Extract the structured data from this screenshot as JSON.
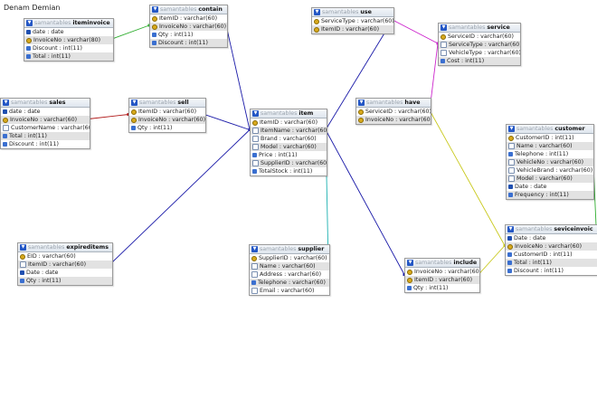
{
  "title": "Denam Demian",
  "tables": [
    {
      "id": "iteminvoice",
      "db": "samantables",
      "name": "iteminvoice",
      "columns": [
        {
          "text": "date : date",
          "icon": "date"
        },
        {
          "text": "InvoiceNo : varchar(80)",
          "icon": "key"
        },
        {
          "text": "Discount : int(11)",
          "icon": "num"
        },
        {
          "text": "Total : int(11)",
          "icon": "num"
        }
      ]
    },
    {
      "id": "contain",
      "db": "samantables",
      "name": "contain",
      "columns": [
        {
          "text": "ItemID : varchar(60)",
          "icon": "key"
        },
        {
          "text": "InvoiceNo : varchar(60)",
          "icon": "key"
        },
        {
          "text": "Qty : int(11)",
          "icon": "num"
        },
        {
          "text": "Discount : int(11)",
          "icon": "num"
        }
      ]
    },
    {
      "id": "use",
      "db": "samantables",
      "name": "use",
      "columns": [
        {
          "text": "ServiceType : varchar(60)",
          "icon": "key"
        },
        {
          "text": "ItemID : varchar(60)",
          "icon": "key"
        }
      ]
    },
    {
      "id": "service",
      "db": "samantables",
      "name": "service",
      "columns": [
        {
          "text": "ServiceID : varchar(60)",
          "icon": "key"
        },
        {
          "text": "ServiceType : varchar(60)",
          "icon": "field"
        },
        {
          "text": "VehicleType : varchar(60)",
          "icon": "field"
        },
        {
          "text": "Cost : int(11)",
          "icon": "num"
        }
      ]
    },
    {
      "id": "sales",
      "db": "samantables",
      "name": "sales",
      "columns": [
        {
          "text": "date : date",
          "icon": "date"
        },
        {
          "text": "InvoiceNo : varchar(60)",
          "icon": "key"
        },
        {
          "text": "CustomerName : varchar(60)",
          "icon": "field"
        },
        {
          "text": "Total : int(11)",
          "icon": "num"
        },
        {
          "text": "Discount : int(11)",
          "icon": "num"
        }
      ]
    },
    {
      "id": "sell",
      "db": "samantables",
      "name": "sell",
      "columns": [
        {
          "text": "ItemID : varchar(60)",
          "icon": "key"
        },
        {
          "text": "InvoiceNo : varchar(60)",
          "icon": "key"
        },
        {
          "text": "Qty : int(11)",
          "icon": "num"
        }
      ]
    },
    {
      "id": "item",
      "db": "samantables",
      "name": "item",
      "columns": [
        {
          "text": "ItemID : varchar(60)",
          "icon": "key"
        },
        {
          "text": "ItemName : varchar(60)",
          "icon": "field"
        },
        {
          "text": "Brand : varchar(60)",
          "icon": "field"
        },
        {
          "text": "Model : varchar(60)",
          "icon": "field"
        },
        {
          "text": "Price : int(11)",
          "icon": "num"
        },
        {
          "text": "SupplierID : varchar(60)",
          "icon": "field"
        },
        {
          "text": "TotalStock : int(11)",
          "icon": "num"
        }
      ]
    },
    {
      "id": "have",
      "db": "samantables",
      "name": "have",
      "columns": [
        {
          "text": "ServiceID : varchar(60)",
          "icon": "key"
        },
        {
          "text": "InvoiceNo : varchar(60)",
          "icon": "key"
        }
      ]
    },
    {
      "id": "customer",
      "db": "samantables",
      "name": "customer",
      "columns": [
        {
          "text": "CustomerID : int(11)",
          "icon": "key"
        },
        {
          "text": "Name : varchar(60)",
          "icon": "field"
        },
        {
          "text": "Telephone : int(11)",
          "icon": "num"
        },
        {
          "text": "VehicleNo : varchar(60)",
          "icon": "field"
        },
        {
          "text": "VehicleBrand : varchar(60)",
          "icon": "field"
        },
        {
          "text": "Model : varchar(60)",
          "icon": "field"
        },
        {
          "text": "Date : date",
          "icon": "date"
        },
        {
          "text": "Frequency : int(11)",
          "icon": "num"
        }
      ]
    },
    {
      "id": "expireditems",
      "db": "samantables",
      "name": "expireditems",
      "columns": [
        {
          "text": "EID : varchar(60)",
          "icon": "key"
        },
        {
          "text": "ItemID : varchar(60)",
          "icon": "field"
        },
        {
          "text": "Date : date",
          "icon": "date"
        },
        {
          "text": "Qty : int(11)",
          "icon": "num"
        }
      ]
    },
    {
      "id": "supplier",
      "db": "samantables",
      "name": "supplier",
      "columns": [
        {
          "text": "SupplierID : varchar(60)",
          "icon": "key"
        },
        {
          "text": "Name : varchar(60)",
          "icon": "field"
        },
        {
          "text": "Address : varchar(60)",
          "icon": "field"
        },
        {
          "text": "Telephone : varchar(60)",
          "icon": "num"
        },
        {
          "text": "Email : varchar(60)",
          "icon": "field"
        }
      ]
    },
    {
      "id": "include",
      "db": "samantables",
      "name": "include",
      "columns": [
        {
          "text": "InvoiceNo : varchar(60)",
          "icon": "key"
        },
        {
          "text": "ItemID : varchar(60)",
          "icon": "key"
        },
        {
          "text": "Qty : int(11)",
          "icon": "num"
        }
      ]
    },
    {
      "id": "seviceinvoice",
      "db": "samantables",
      "name": "seviceinvoic",
      "columns": [
        {
          "text": "Date : date",
          "icon": "date"
        },
        {
          "text": "InvoiceNo : varchar(60)",
          "icon": "key"
        },
        {
          "text": "CustomerID : int(11)",
          "icon": "num"
        },
        {
          "text": "Total : int(11)",
          "icon": "num"
        },
        {
          "text": "Discount : int(11)",
          "icon": "num"
        }
      ]
    }
  ],
  "relations": [
    {
      "from": "iteminvoice",
      "to": "contain",
      "color": "#2fae2f"
    },
    {
      "from": "contain",
      "to": "item",
      "color": "#1a1aa8"
    },
    {
      "from": "sales",
      "to": "sell",
      "color": "#b01818"
    },
    {
      "from": "sell",
      "to": "item",
      "color": "#1a1aa8"
    },
    {
      "from": "item",
      "to": "use",
      "color": "#1a1aa8"
    },
    {
      "from": "use",
      "to": "service",
      "color": "#cc22cc"
    },
    {
      "from": "service",
      "to": "have",
      "color": "#cc22cc"
    },
    {
      "from": "have",
      "to": "seviceinvoice",
      "color": "#c8c81a"
    },
    {
      "from": "customer",
      "to": "seviceinvoice",
      "color": "#2fae2f"
    },
    {
      "from": "item",
      "to": "include",
      "color": "#1a1aa8"
    },
    {
      "from": "include",
      "to": "seviceinvoice",
      "color": "#c8c81a"
    },
    {
      "from": "expireditems",
      "to": "item",
      "color": "#1a1aa8"
    },
    {
      "from": "supplier",
      "to": "item",
      "color": "#1ab0b0"
    }
  ]
}
